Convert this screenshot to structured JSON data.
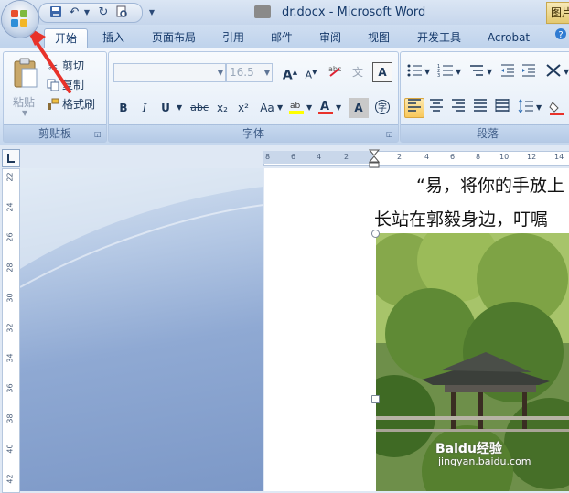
{
  "window": {
    "title": "dr.docx - Microsoft Word",
    "context_tab": "图片"
  },
  "tabs": [
    {
      "label": "开始",
      "active": true
    },
    {
      "label": "插入"
    },
    {
      "label": "页面布局"
    },
    {
      "label": "引用"
    },
    {
      "label": "邮件"
    },
    {
      "label": "审阅"
    },
    {
      "label": "视图"
    },
    {
      "label": "开发工具"
    },
    {
      "label": "Acrobat"
    }
  ],
  "clipboard": {
    "paste": "粘贴",
    "cut": "剪切",
    "copy": "复制",
    "format_painter": "格式刷",
    "group_label": "剪贴板"
  },
  "font": {
    "font_name": "",
    "font_size": "16.5",
    "group_label": "字体",
    "bold": "B",
    "italic": "I",
    "underline": "U",
    "strike": "abc",
    "subscript": "x₂",
    "superscript": "x²",
    "change_case": "Aa",
    "grow": "A",
    "shrink": "A"
  },
  "paragraph": {
    "group_label": "段落"
  },
  "ruler": {
    "horizontal": [
      "8",
      "6",
      "4",
      "2",
      "2",
      "4",
      "6",
      "8",
      "10",
      "12",
      "14"
    ],
    "vertical": [
      "22",
      "24",
      "26",
      "28",
      "30",
      "32",
      "34",
      "36",
      "38",
      "40",
      "42"
    ]
  },
  "document": {
    "line1": "“易，将你的手放上",
    "line2": "长站在郭毅身边，叮嘱"
  },
  "watermark": {
    "brand": "Baidu经验",
    "url": "jingyan.baidu.com"
  },
  "colors": {
    "accent": "#f8c85b",
    "arrow": "#e8322a",
    "highlight": "#ffff00",
    "font_color": "#e8322a"
  }
}
